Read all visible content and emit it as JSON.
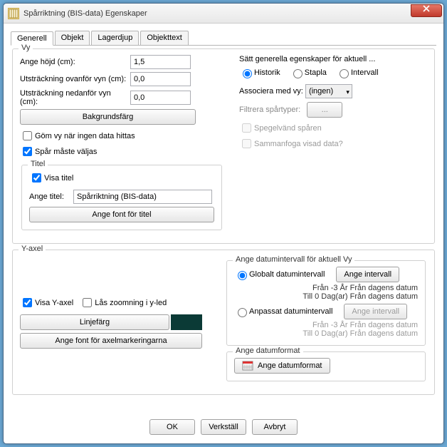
{
  "window": {
    "title": "Spårriktning (BIS-data) Egenskaper"
  },
  "tabs": [
    "Generell",
    "Objekt",
    "Lagerdjup",
    "Objekttext"
  ],
  "vy": {
    "legend": "Vy",
    "height_label": "Ange höjd (cm):",
    "height_value": "1,5",
    "ext_above_label": "Utsträckning ovanför vyn (cm):",
    "ext_above_value": "0,0",
    "ext_below_label": "Utsträckning nedanför vyn (cm):",
    "ext_below_value": "0,0",
    "bg_button": "Bakgrundsfärg",
    "hide_when_no_data": "Göm vy när ingen data hittas",
    "track_must_select": "Spår måste väljas",
    "right": {
      "set_general": "Sätt generella egenskaper för aktuell ...",
      "r_history": "Historik",
      "r_stack": "Stapla",
      "r_interval": "Intervall",
      "assoc_label": "Associera med vy:",
      "assoc_value": "(ingen)",
      "filter_label": "Filtrera spårtyper:",
      "filter_btn": "...",
      "mirror": "Spegelvänd spåren",
      "merge": "Sammanfoga visad data?"
    },
    "titel": {
      "legend": "Titel",
      "show_title": "Visa titel",
      "title_label": "Ange titel:",
      "title_value": "Spårriktning (BIS-data)",
      "font_btn": "Ange font för titel"
    }
  },
  "yaxel": {
    "legend": "Y-axel",
    "show_y": "Visa Y-axel",
    "lock_zoom": "Lås zoomning i y-led",
    "line_color_btn": "Linjefärg",
    "font_axis_btn": "Ange font för axelmarkeringarna",
    "date_fs": {
      "legend": "Ange datumintervall för aktuell Vy",
      "global_radio": "Globalt datumintervall",
      "set_interval_btn": "Ange intervall",
      "from1": "Från -3 År Från dagens datum",
      "to1": "Till 0 Dag(ar) Från dagens datum",
      "custom_radio": "Anpassat datumintervall",
      "set_interval_btn2": "Ange intervall",
      "from2": "Från -3 År Från dagens datum",
      "to2": "Till 0 Dag(ar) Från dagens datum"
    },
    "datefmt_fs": {
      "legend": "Ange datumformat",
      "btn": "Ange datumformat"
    }
  },
  "buttons": {
    "ok": "OK",
    "apply": "Verkställ",
    "cancel": "Avbryt"
  }
}
